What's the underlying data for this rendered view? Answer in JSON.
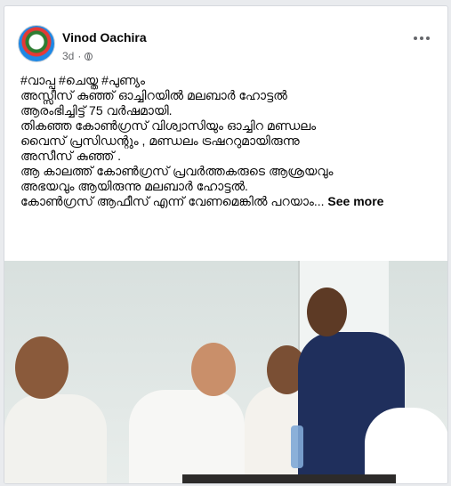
{
  "post": {
    "author": "Vinod Oachira",
    "time": "3d",
    "privacy_icon": "globe-icon",
    "more_icon": "more-options-icon",
    "lines": [
      "#വാപ്പ #ചെയ്ത #പുണ്യം",
      "അസ്സീസ് കുഞ്ഞ് ഓച്ചിറയിൽ മലബാർ ഹോട്ടൽ",
      "ആരംഭിച്ചിട്ട് 75 വർഷമായി.",
      "തികഞ്ഞ കോൺഗ്രസ് വിശ്വാസിയും ഓച്ചിറ മണ്ഡലം",
      "വൈസ് പ്രസിഡന്റും , മണ്ഡലം ട്രഷററുമായിരുന്നു",
      "അസീസ് കുഞ്ഞ് .",
      "ആ കാലത്ത് കോൺഗ്രസ് പ്രവർത്തകരുടെ ആശ്രയവും",
      "അഭയവും ആയിരുന്നു മലബാർ ഹോട്ടൽ.",
      "കോൺഗ്രസ് ആഫീസ് എന്ന് വേണമെങ്കിൽ പറയാം..."
    ],
    "see_more": "See more"
  }
}
